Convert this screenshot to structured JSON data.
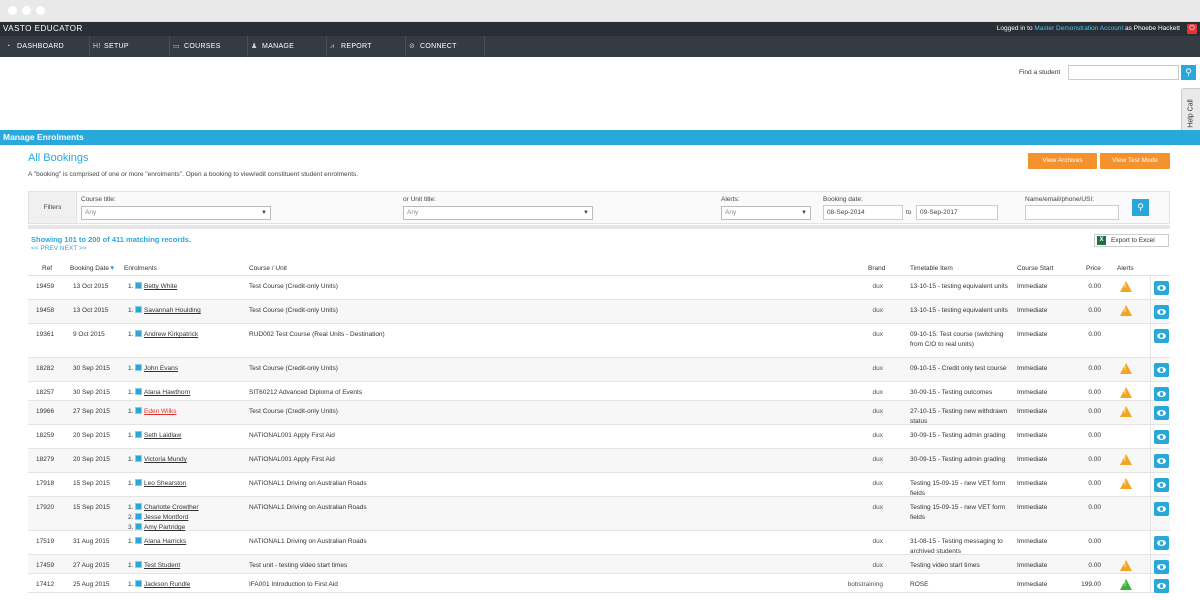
{
  "app": {
    "brand": "VASTO EDUCATOR",
    "login_prefix": "Logged in to ",
    "account": "Master Demonstration Account",
    "login_mid": " as ",
    "user": "Phoebe Hackett",
    "logout_glyph": "⏻"
  },
  "nav": [
    {
      "label": "DASHBOARD",
      "icon": "dashboard-icon",
      "glyph": "◔"
    },
    {
      "label": "SETUP",
      "icon": "setup-icon",
      "glyph": "H!"
    },
    {
      "label": "COURSES",
      "icon": "courses-icon",
      "glyph": "▭"
    },
    {
      "label": "MANAGE",
      "icon": "manage-icon",
      "glyph": "♟"
    },
    {
      "label": "REPORT",
      "icon": "report-icon",
      "glyph": "⩘"
    },
    {
      "label": "CONNECT",
      "icon": "connect-icon",
      "glyph": "⊘"
    }
  ],
  "find_student": {
    "label": "Find a student",
    "value": "",
    "glyph": "⚲"
  },
  "help_call": "Help Call",
  "section_title": "Manage Enrolments",
  "page": {
    "title": "All Bookings",
    "subtitle": "A \"booking\" is comprised of one or more \"enrolments\". Open a booking to view/edit constituent student enrolments.",
    "view_archives": "View Archives",
    "view_test_mode": "View Test Mode"
  },
  "filters": {
    "label": "Filters",
    "course_title_label": "Course title:",
    "course_title_value": "Any",
    "unit_title_label": "or Unit title:",
    "unit_title_value": "Any",
    "alerts_label": "Alerts:",
    "alerts_value": "Any",
    "booking_date_label": "Booking date:",
    "date_from": "08-Sep-2014",
    "date_to_label": "to",
    "date_to": "09-Sep-2017",
    "name_label": "Name/email/phone/USI:",
    "name_value": "",
    "search_glyph": "⚲",
    "select_arrow": "▼"
  },
  "results": {
    "showing": "Showing 101 to 200 of 411 matching records.",
    "pager": "<< PREV NEXT >>",
    "export": "Export to Excel",
    "export_glyph": "X"
  },
  "table": {
    "headers": {
      "ref": "Ref",
      "date": "Booking Date",
      "sort_glyph": "▼",
      "enrolments": "Enrolments",
      "course": "Course / Unit",
      "brand": "Brand",
      "timetable": "Timetable Item",
      "start": "Course Start",
      "price": "Price",
      "alerts": "Alerts"
    },
    "alert_glyph": "!",
    "rows": [
      {
        "ref": "19459",
        "date": "13 Oct 2015",
        "enrolments": [
          {
            "n": "1.",
            "name": "Betty White"
          }
        ],
        "course": "Test Course (Credit-only Units)",
        "brand": "dux",
        "timetable": "13-10-15 - testing equivalent units",
        "start": "Immediate",
        "price": "0.00",
        "alert": "warning"
      },
      {
        "ref": "19458",
        "date": "13 Oct 2015",
        "enrolments": [
          {
            "n": "1.",
            "name": "Savannah Houlding"
          }
        ],
        "course": "Test Course (Credit-only Units)",
        "brand": "dux",
        "timetable": "13-10-15 - testing equivalent units",
        "start": "Immediate",
        "price": "0.00",
        "alert": "warning"
      },
      {
        "ref": "19361",
        "date": "9 Oct 2015",
        "enrolments": [
          {
            "n": "1.",
            "name": "Andrew Kirkpatrick"
          }
        ],
        "course": "RUD002 Test Course (Real Units - Destination)",
        "brand": "dux",
        "timetable": "09-10-15: Test course (switching from C/O to real units)",
        "start": "Immediate",
        "price": "0.00",
        "alert": ""
      },
      {
        "ref": "18282",
        "date": "30 Sep 2015",
        "enrolments": [
          {
            "n": "1.",
            "name": "John Evans"
          }
        ],
        "course": "Test Course (Credit-only Units)",
        "brand": "dux",
        "timetable": "09-10-15 - Credit only test course",
        "start": "Immediate",
        "price": "0.00",
        "alert": "warning"
      },
      {
        "ref": "18257",
        "date": "30 Sep 2015",
        "enrolments": [
          {
            "n": "1.",
            "name": "Alana Hawthorn"
          }
        ],
        "course": "SIT60212 Advanced Diploma of Events",
        "brand": "dux",
        "timetable": "30-09-15 - Testing outcomes",
        "start": "Immediate",
        "price": "0.00",
        "alert": "warning"
      },
      {
        "ref": "19966",
        "date": "27 Sep 2015",
        "enrolments": [
          {
            "n": "1.",
            "name": "Eden Wilks",
            "red": true
          }
        ],
        "course": "Test Course (Credit-only Units)",
        "brand": "dux",
        "timetable": "27-10-15 - Testing new withdrawn status",
        "start": "Immediate",
        "price": "0.00",
        "alert": "warning"
      },
      {
        "ref": "18259",
        "date": "20 Sep 2015",
        "enrolments": [
          {
            "n": "1.",
            "name": "Seth Laidlaw"
          }
        ],
        "course": "NATIONAL001 Apply First Aid",
        "brand": "dux",
        "timetable": "30-09-15 - Testing admin grading",
        "start": "Immediate",
        "price": "0.00",
        "alert": ""
      },
      {
        "ref": "18279",
        "date": "20 Sep 2015",
        "enrolments": [
          {
            "n": "1.",
            "name": "Victoria Mundy"
          }
        ],
        "course": "NATIONAL001 Apply First Aid",
        "brand": "dux",
        "timetable": "30-09-15 - Testing admin grading",
        "start": "Immediate",
        "price": "0.00",
        "alert": "warning"
      },
      {
        "ref": "17918",
        "date": "15 Sep 2015",
        "enrolments": [
          {
            "n": "1.",
            "name": "Leo Shearston"
          }
        ],
        "course": "NATIONAL1 Driving on Australian Roads",
        "brand": "dux",
        "timetable": "Testing 15-09-15 - new VET form fields",
        "start": "Immediate",
        "price": "0.00",
        "alert": "warning"
      },
      {
        "ref": "17920",
        "date": "15 Sep 2015",
        "enrolments": [
          {
            "n": "1.",
            "name": "Charlotte Crowther"
          },
          {
            "n": "2.",
            "name": "Jesse Montford"
          },
          {
            "n": "3.",
            "name": "Amy Partridge"
          }
        ],
        "course": "NATIONAL1 Driving on Australian Roads",
        "brand": "dux",
        "timetable": "Testing 15-09-15 - new VET form fields",
        "start": "Immediate",
        "price": "0.00",
        "alert": ""
      },
      {
        "ref": "17519",
        "date": "31 Aug 2015",
        "enrolments": [
          {
            "n": "1.",
            "name": "Alana Harricks"
          }
        ],
        "course": "NATIONAL1 Driving on Australian Roads",
        "brand": "dux",
        "timetable": "31-08-15 - Testing messaging to archived students",
        "start": "Immediate",
        "price": "0.00",
        "alert": ""
      },
      {
        "ref": "17459",
        "date": "27 Aug 2015",
        "enrolments": [
          {
            "n": "1.",
            "name": "Test Student"
          }
        ],
        "course": "Test unit - testing video start times",
        "brand": "dux",
        "timetable": "Testing video start times",
        "start": "Immediate",
        "price": "0.00",
        "alert": "warning"
      },
      {
        "ref": "17412",
        "date": "25 Aug 2015",
        "enrolments": [
          {
            "n": "1.",
            "name": "Jackson Rundle"
          }
        ],
        "course": "IFA001 Introduction to First Aid",
        "brand": "bobstraining",
        "timetable": "ROSE",
        "start": "Immediate",
        "price": "199.00",
        "alert": "ok"
      }
    ]
  },
  "colors": {
    "accent": "#29a8dc",
    "orange": "#f3922f",
    "navbar": "#353b43",
    "warning": "#f2a521",
    "ok": "#3bb33b"
  }
}
